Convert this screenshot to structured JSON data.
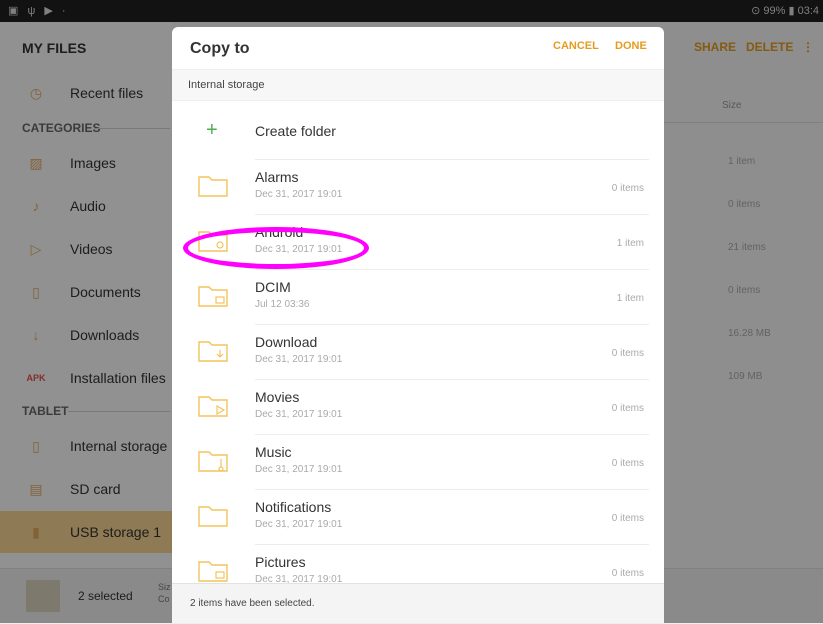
{
  "status_bar": {
    "left_icons": "▣ ψ ▶ ·",
    "right_text": "⊙ 99% ▮ 03:4"
  },
  "sidebar": {
    "title": "MY FILES",
    "recent": {
      "label": "Recent files",
      "icon": "clock-icon"
    },
    "categories_label": "CATEGORIES",
    "categories": [
      {
        "label": "Images",
        "icon": "image-icon"
      },
      {
        "label": "Audio",
        "icon": "music-note-icon"
      },
      {
        "label": "Videos",
        "icon": "video-icon"
      },
      {
        "label": "Documents",
        "icon": "document-icon"
      },
      {
        "label": "Downloads",
        "icon": "download-icon"
      },
      {
        "label": "Installation files",
        "icon": "apk-icon",
        "icon_text": "APK"
      }
    ],
    "tablet_label": "TABLET",
    "storage": [
      {
        "label": "Internal storage",
        "icon": "phone-icon"
      },
      {
        "label": "SD card",
        "icon": "sd-card-icon"
      },
      {
        "label": "USB storage 1",
        "icon": "usb-icon"
      }
    ]
  },
  "main": {
    "share_label": "SHARE",
    "delete_label": "DELETE",
    "size_header": "Size",
    "size_values": [
      "1 item",
      "0 items",
      "21 items",
      "0 items",
      "16.28 MB",
      "109 MB"
    ],
    "bottom_count": "2 selected",
    "bottom_meta": "Siz Co"
  },
  "dialog": {
    "title": "Copy to",
    "cancel_label": "CANCEL",
    "done_label": "DONE",
    "path": "Internal storage",
    "create_folder_label": "Create folder",
    "folders": [
      {
        "name": "Alarms",
        "date": "Dec 31, 2017 19:01",
        "count": "0 items"
      },
      {
        "name": "Android",
        "date": "Dec 31, 2017 19:01",
        "count": "1 item"
      },
      {
        "name": "DCIM",
        "date": "Jul 12 03:36",
        "count": "1 item"
      },
      {
        "name": "Download",
        "date": "Dec 31, 2017 19:01",
        "count": "0 items"
      },
      {
        "name": "Movies",
        "date": "Dec 31, 2017 19:01",
        "count": "0 items"
      },
      {
        "name": "Music",
        "date": "Dec 31, 2017 19:01",
        "count": "0 items"
      },
      {
        "name": "Notifications",
        "date": "Dec 31, 2017 19:01",
        "count": "0 items"
      },
      {
        "name": "Pictures",
        "date": "Dec 31, 2017 19:01",
        "count": "0 items"
      }
    ],
    "footer_text": "2 items have been selected."
  },
  "colors": {
    "accent": "#e59b1f",
    "highlight": "#ff00ff",
    "folder": "#f2c35c"
  }
}
